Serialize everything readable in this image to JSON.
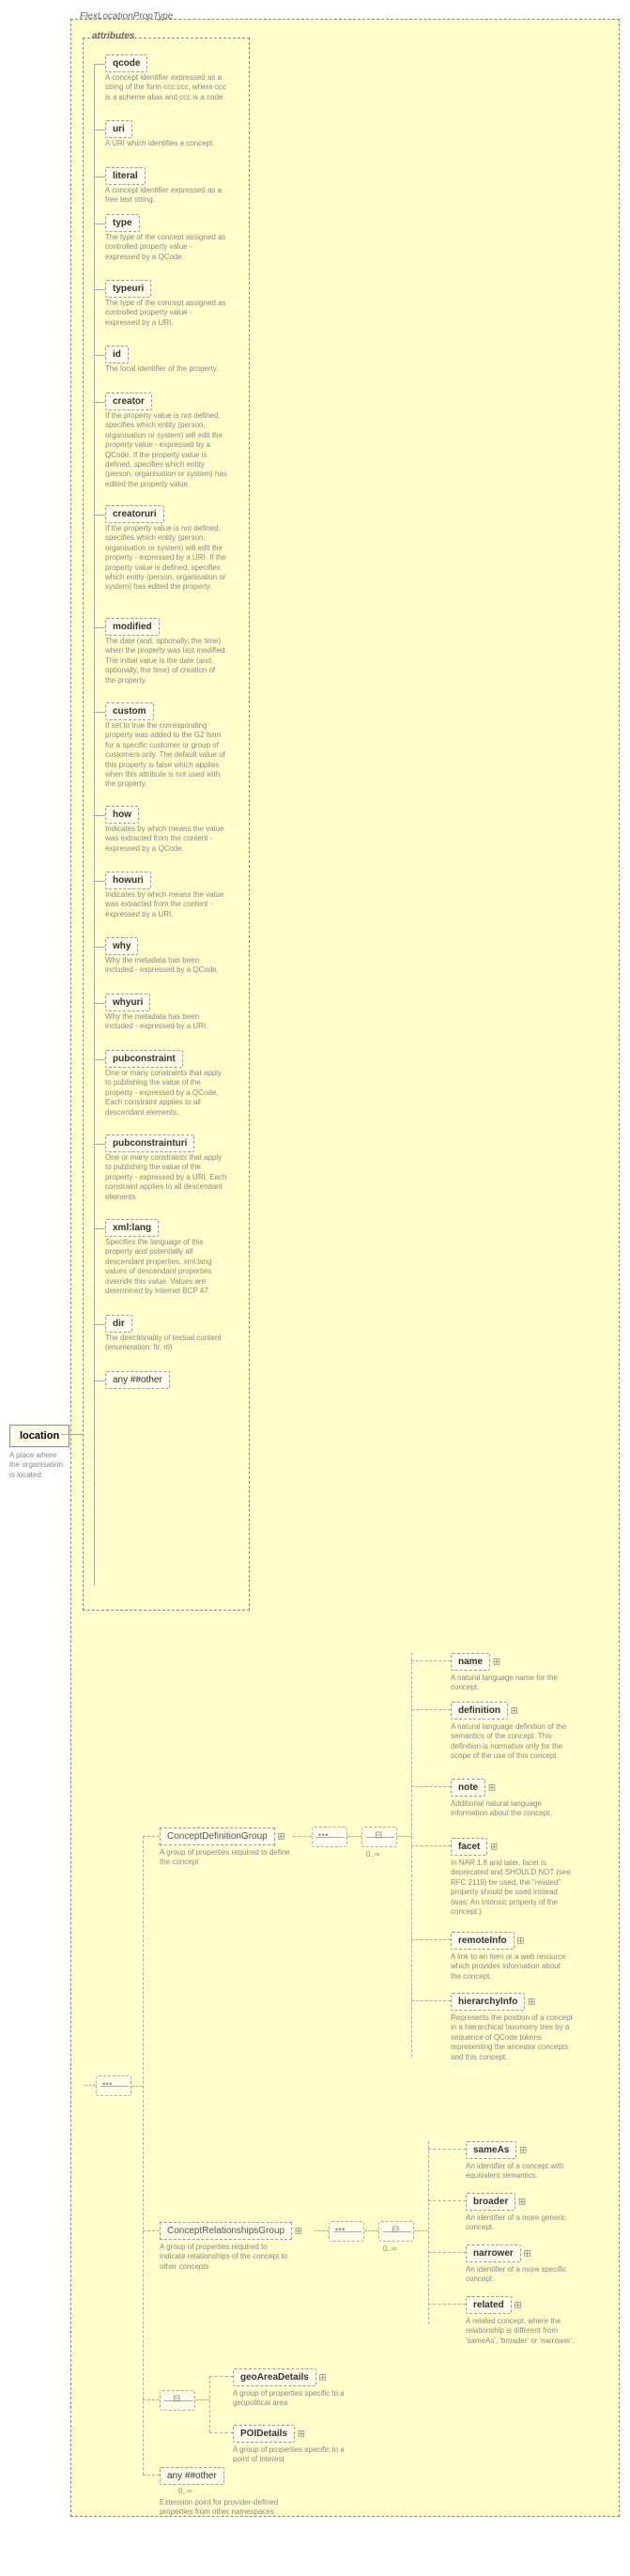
{
  "type_name": "FlexLocationPropType",
  "root": {
    "label": "location",
    "desc": "A place where the organisation is located."
  },
  "attributes_section": {
    "label": "attributes"
  },
  "attrs": [
    {
      "name": "qcode",
      "desc": "A concept identifier expressed as a string of the form ccc:ccc, where ccc is a scheme alias and ccc is a code."
    },
    {
      "name": "uri",
      "desc": "A URI which identifies a concept."
    },
    {
      "name": "literal",
      "desc": "A concept identifier expressed as a free text string."
    },
    {
      "name": "type",
      "desc": "The type of the concept assigned as controlled property value - expressed by a QCode."
    },
    {
      "name": "typeuri",
      "desc": "The type of the concept assigned as controlled property value - expressed by a URI."
    },
    {
      "name": "id",
      "desc": "The local identifier of the property."
    },
    {
      "name": "creator",
      "desc": "If the property value is not defined, specifies which entity (person, organisation or system) will edit the property value - expressed by a QCode. If the property value is defined, specifies which entity (person, organisation or system) has edited the property value."
    },
    {
      "name": "creatoruri",
      "desc": "If the property value is not defined, specifies which entity (person, organisation or system) will edit the property - expressed by a URI. If the property value is defined, specifies which entity (person, organisation or system) has edited the property."
    },
    {
      "name": "modified",
      "desc": "The date (and, optionally, the time) when the property was last modified. The initial value is the date (and, optionally, the time) of creation of the property."
    },
    {
      "name": "custom",
      "desc": "If set to true the corresponding property was added to the G2 Item for a specific customer or group of customers only. The default value of this property is false which applies when this attribute is not used with the property."
    },
    {
      "name": "how",
      "desc": "Indicates by which means the value was extracted from the content - expressed by a QCode."
    },
    {
      "name": "howuri",
      "desc": "Indicates by which means the value was extracted from the content - expressed by a URI."
    },
    {
      "name": "why",
      "desc": "Why the metadata has been included - expressed by a QCode."
    },
    {
      "name": "whyuri",
      "desc": "Why the metadata has been included - expressed by a URI."
    },
    {
      "name": "pubconstraint",
      "desc": "One or many constraints that apply to publishing the value of the property - expressed by a QCode. Each constraint applies to all descendant elements."
    },
    {
      "name": "pubconstrainturi",
      "desc": "One or many constraints that apply to publishing the value of the property - expressed by a URI. Each constraint applies to all descendant elements."
    },
    {
      "name": "xml:lang",
      "desc": "Specifies the language of this property and potentially all descendant properties. xml:lang values of descendant properties override this value. Values are determined by Internet BCP 47."
    },
    {
      "name": "dir",
      "desc": "The directionality of textual content (enumeration: ltr, rtl)"
    }
  ],
  "anyattr": "any ##other",
  "groups": {
    "cdg": {
      "label": "ConceptDefinitionGroup",
      "desc": "A group of properties required to define the concept"
    },
    "crg": {
      "label": "ConceptRelationshipsGroup",
      "desc": "A group of properties required to indicate relationships of the concept to other concepts"
    },
    "geo": {
      "label": "geoAreaDetails",
      "desc": "A group of properties specific to a geopolitical area"
    },
    "poi": {
      "label": "POIDetails",
      "desc": "A group of properties specific to a point of interest"
    },
    "anyother": {
      "label": "any ##other",
      "desc": "Extension point for provider-defined properties from other namespaces"
    }
  },
  "cdg_children": [
    {
      "name": "name",
      "desc": "A natural language name for the concept."
    },
    {
      "name": "definition",
      "desc": "A natural language definition of the semantics of the concept. This definition is normative only for the scope of the use of this concept."
    },
    {
      "name": "note",
      "desc": "Additional natural language information about the concept."
    },
    {
      "name": "facet",
      "desc": "In NAR 1.8 and later, facet is deprecated and SHOULD NOT (see RFC 2119) be used, the \"related\" property should be used instead. (was: An intrinsic property of the concept.)"
    },
    {
      "name": "remoteInfo",
      "desc": "A link to an item or a web resource which provides information about the concept."
    },
    {
      "name": "hierarchyInfo",
      "desc": "Represents the position of a concept in a hierarchical taxonomy tree by a sequence of QCode tokens representing the ancestor concepts and this concept."
    }
  ],
  "crg_children": [
    {
      "name": "sameAs",
      "desc": "An identifier of a concept with equivalent semantics."
    },
    {
      "name": "broader",
      "desc": "An identifier of a more generic concept."
    },
    {
      "name": "narrower",
      "desc": "An identifier of a more specific concept."
    },
    {
      "name": "related",
      "desc": "A related concept, where the relationship is different from 'sameAs', 'broader' or 'narrower'."
    }
  ],
  "cards": {
    "zinf": "0..∞"
  }
}
